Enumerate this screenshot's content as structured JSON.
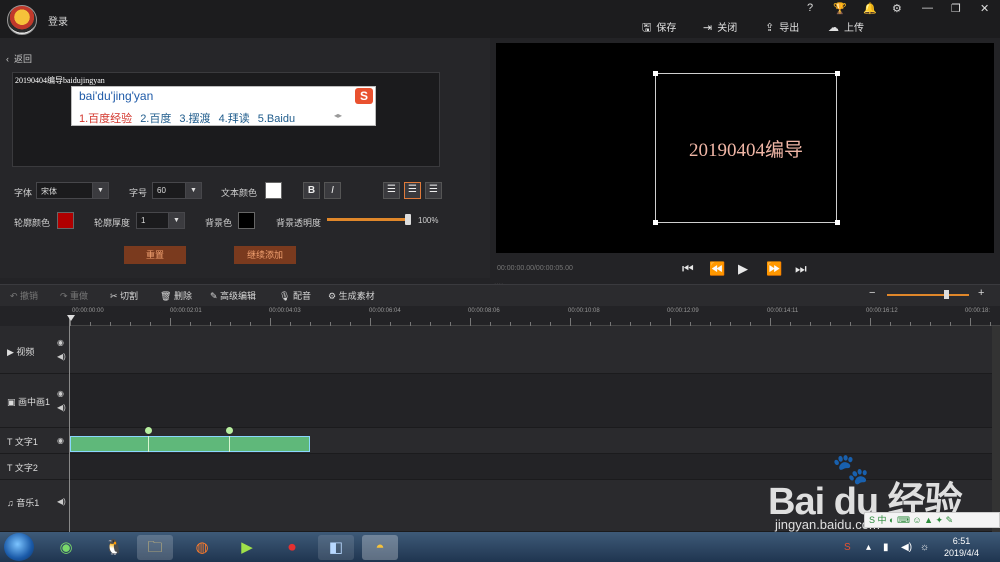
{
  "header": {
    "login_label": "登录",
    "window_controls": [
      "?",
      "🏆",
      "🔔",
      "⚙",
      "—",
      "❐",
      "✕"
    ],
    "save_label": "保存",
    "close_label": "关闭",
    "export_label": "导出",
    "upload_label": "上传"
  },
  "editor": {
    "back_label": "返回",
    "text_value": "20190404编导baidujingyan",
    "ime": {
      "composition": "bai'du'jing'yan",
      "candidates": [
        "1.百度经验",
        "2.百度",
        "3.摆渡",
        "4.拜读",
        "5.Baidu"
      ],
      "logo": "S"
    },
    "font_label": "字体",
    "font_value": "宋体",
    "size_label": "字号",
    "size_value": "60",
    "text_color_label": "文本颜色",
    "bold_label": "B",
    "italic_label": "I",
    "outline_color_label": "轮廓颜色",
    "outline_width_label": "轮廓厚度",
    "outline_width_value": "1",
    "bg_color_label": "背景色",
    "bg_opacity_label": "背景透明度",
    "bg_opacity_value": "100%",
    "reset_label": "重置",
    "continue_add_label": "继续添加",
    "colors": {
      "text": "#ffffff",
      "outline": "#b00000",
      "background": "#000000",
      "accent": "#e0872a"
    }
  },
  "preview": {
    "text": "20190404编导",
    "timecode": "00:00:00.00/00:00:05.00",
    "controls": [
      "⏮",
      "⏪",
      "▶",
      "⏩",
      "⏭"
    ]
  },
  "edit_toolbar": {
    "undo": "撤销",
    "redo": "重做",
    "cut": "切割",
    "delete": "删除",
    "advanced_edit": "高级编辑",
    "dub": "配音",
    "generate": "生成素材",
    "zoom_minus": "−",
    "zoom_plus": "+"
  },
  "timeline": {
    "ticks": [
      "00:00:00:00",
      "00:00:02:01",
      "00:00:04:03",
      "00:00:06:04",
      "00:00:08:06",
      "00:00:10:08",
      "00:00:12:09",
      "00:00:14:11",
      "00:00:16:12",
      "00:00:18:"
    ],
    "tracks": [
      "视频",
      "画中画1",
      "文字1",
      "文字2",
      "音乐1"
    ]
  },
  "taskbar": {
    "time": "6:51",
    "date": "2019/4/4"
  },
  "watermark": {
    "brand": "Bai du 经验",
    "url": "jingyan.baidu.com"
  }
}
